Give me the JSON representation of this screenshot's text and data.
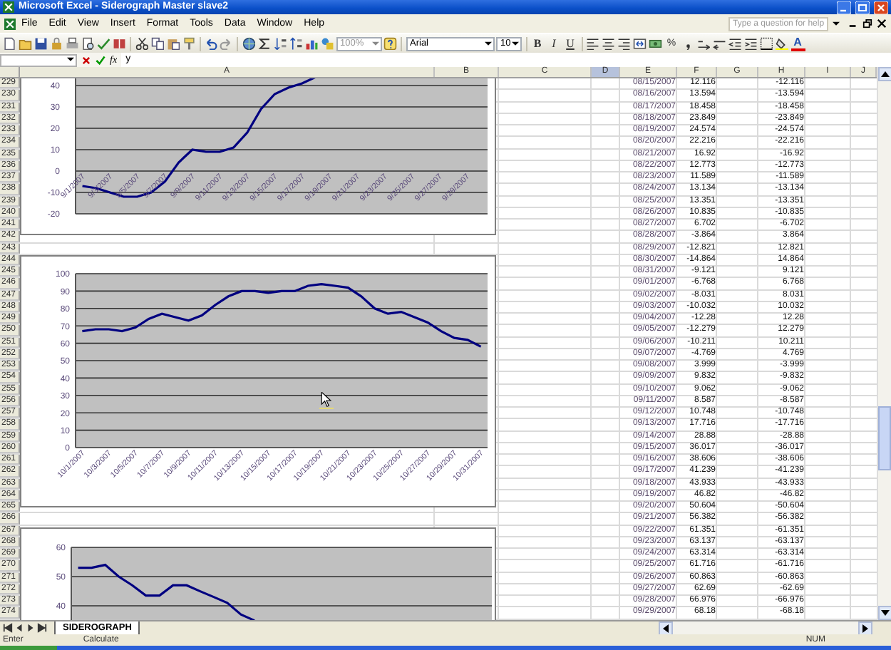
{
  "window": {
    "title": "Microsoft Excel - Siderograph Master slave2"
  },
  "menu": {
    "items": [
      "File",
      "Edit",
      "View",
      "Insert",
      "Format",
      "Tools",
      "Data",
      "Window",
      "Help"
    ],
    "help_placeholder": "Type a question for help"
  },
  "toolbar": {
    "zoom": "100%",
    "font": "Arial",
    "font_size": "10",
    "format_buttons": [
      {
        "label": "B",
        "kind": "bold"
      },
      {
        "label": "I",
        "kind": "italic"
      },
      {
        "label": "U",
        "kind": "underline"
      }
    ],
    "percent_button": "%",
    "font_color_button": "A"
  },
  "formula_bar": {
    "function_label": "fx",
    "value": "y"
  },
  "columns": [
    {
      "label": "A",
      "selected": false
    },
    {
      "label": "B",
      "selected": false
    },
    {
      "label": "C",
      "selected": false
    },
    {
      "label": "D",
      "selected": true
    },
    {
      "label": "E",
      "selected": false
    },
    {
      "label": "F",
      "selected": false
    },
    {
      "label": "G",
      "selected": false
    },
    {
      "label": "H",
      "selected": false
    },
    {
      "label": "I",
      "selected": false
    },
    {
      "label": "J",
      "selected": false
    }
  ],
  "rows": [
    {
      "number": "229",
      "column_e": "08/15/2007",
      "column_f": "12.116",
      "column_h": "-12.116"
    },
    {
      "number": "230",
      "column_e": "08/16/2007",
      "column_f": "13.594",
      "column_h": "-13.594"
    },
    {
      "number": "231",
      "column_e": "08/17/2007",
      "column_f": "18.458",
      "column_h": "-18.458"
    },
    {
      "number": "232",
      "column_e": "08/18/2007",
      "column_f": "23.849",
      "column_h": "-23.849"
    },
    {
      "number": "233",
      "column_e": "08/19/2007",
      "column_f": "24.574",
      "column_h": "-24.574"
    },
    {
      "number": "234",
      "column_e": "08/20/2007",
      "column_f": "22.216",
      "column_h": "-22.216"
    },
    {
      "number": "235",
      "column_e": "08/21/2007",
      "column_f": "16.92",
      "column_h": "-16.92"
    },
    {
      "number": "236",
      "column_e": "08/22/2007",
      "column_f": "12.773",
      "column_h": "-12.773"
    },
    {
      "number": "237",
      "column_e": "08/23/2007",
      "column_f": "11.589",
      "column_h": "-11.589"
    },
    {
      "number": "238",
      "column_e": "08/24/2007",
      "column_f": "13.134",
      "column_h": "-13.134"
    },
    {
      "number": "239",
      "column_e": "08/25/2007",
      "column_f": "13.351",
      "column_h": "-13.351"
    },
    {
      "number": "240",
      "column_e": "08/26/2007",
      "column_f": "10.835",
      "column_h": "-10.835"
    },
    {
      "number": "241",
      "column_e": "08/27/2007",
      "column_f": "6.702",
      "column_h": "-6.702"
    },
    {
      "number": "242",
      "column_e": "08/28/2007",
      "column_f": "-3.864",
      "column_h": "3.864"
    },
    {
      "number": "243",
      "column_e": "08/29/2007",
      "column_f": "-12.821",
      "column_h": "12.821"
    },
    {
      "number": "244",
      "column_e": "08/30/2007",
      "column_f": "-14.864",
      "column_h": "14.864"
    },
    {
      "number": "245",
      "column_e": "08/31/2007",
      "column_f": "-9.121",
      "column_h": "9.121"
    },
    {
      "number": "246",
      "column_e": "09/01/2007",
      "column_f": "-6.768",
      "column_h": "6.768"
    },
    {
      "number": "247",
      "column_e": "09/02/2007",
      "column_f": "-8.031",
      "column_h": "8.031"
    },
    {
      "number": "248",
      "column_e": "09/03/2007",
      "column_f": "-10.032",
      "column_h": "10.032"
    },
    {
      "number": "249",
      "column_e": "09/04/2007",
      "column_f": "-12.28",
      "column_h": "12.28"
    },
    {
      "number": "250",
      "column_e": "09/05/2007",
      "column_f": "-12.279",
      "column_h": "12.279"
    },
    {
      "number": "251",
      "column_e": "09/06/2007",
      "column_f": "-10.211",
      "column_h": "10.211"
    },
    {
      "number": "252",
      "column_e": "09/07/2007",
      "column_f": "-4.769",
      "column_h": "4.769"
    },
    {
      "number": "253",
      "column_e": "09/08/2007",
      "column_f": "3.999",
      "column_h": "-3.999"
    },
    {
      "number": "254",
      "column_e": "09/09/2007",
      "column_f": "9.832",
      "column_h": "-9.832"
    },
    {
      "number": "255",
      "column_e": "09/10/2007",
      "column_f": "9.062",
      "column_h": "-9.062"
    },
    {
      "number": "256",
      "column_e": "09/11/2007",
      "column_f": "8.587",
      "column_h": "-8.587"
    },
    {
      "number": "257",
      "column_e": "09/12/2007",
      "column_f": "10.748",
      "column_h": "-10.748"
    },
    {
      "number": "258",
      "column_e": "09/13/2007",
      "column_f": "17.716",
      "column_h": "-17.716"
    },
    {
      "number": "259",
      "column_e": "09/14/2007",
      "column_f": "28.88",
      "column_h": "-28.88"
    },
    {
      "number": "260",
      "column_e": "09/15/2007",
      "column_f": "36.017",
      "column_h": "-36.017"
    },
    {
      "number": "261",
      "column_e": "09/16/2007",
      "column_f": "38.606",
      "column_h": "-38.606"
    },
    {
      "number": "262",
      "column_e": "09/17/2007",
      "column_f": "41.239",
      "column_h": "-41.239"
    },
    {
      "number": "263",
      "column_e": "09/18/2007",
      "column_f": "43.933",
      "column_h": "-43.933"
    },
    {
      "number": "264",
      "column_e": "09/19/2007",
      "column_f": "46.82",
      "column_h": "-46.82"
    },
    {
      "number": "265",
      "column_e": "09/20/2007",
      "column_f": "50.604",
      "column_h": "-50.604"
    },
    {
      "number": "266",
      "column_e": "09/21/2007",
      "column_f": "56.382",
      "column_h": "-56.382"
    },
    {
      "number": "267",
      "column_e": "09/22/2007",
      "column_f": "61.351",
      "column_h": "-61.351"
    },
    {
      "number": "268",
      "column_e": "09/23/2007",
      "column_f": "63.137",
      "column_h": "-63.137"
    },
    {
      "number": "269",
      "column_e": "09/24/2007",
      "column_f": "63.314",
      "column_h": "-63.314"
    },
    {
      "number": "270",
      "column_e": "09/25/2007",
      "column_f": "61.716",
      "column_h": "-61.716"
    },
    {
      "number": "271",
      "column_e": "09/26/2007",
      "column_f": "60.863",
      "column_h": "-60.863"
    },
    {
      "number": "272",
      "column_e": "09/27/2007",
      "column_f": "62.69",
      "column_h": "-62.69"
    },
    {
      "number": "273",
      "column_e": "09/28/2007",
      "column_f": "66.976",
      "column_h": "-66.976"
    },
    {
      "number": "274",
      "column_e": "09/29/2007",
      "column_f": "68.18",
      "column_h": "-68.18"
    }
  ],
  "charts": [
    {
      "chart_data": {
        "type": "line",
        "grid": true,
        "ylim": [
          -20,
          50
        ],
        "yticks": [
          -20,
          -10,
          0,
          10,
          20,
          30,
          40
        ],
        "categories": [
          "9/1/2007",
          null,
          "9/3/2007",
          null,
          "9/5/2007",
          null,
          "9/7/2007",
          null,
          "9/9/2007",
          null,
          "9/11/2007",
          null,
          "9/13/2007",
          null,
          "9/15/2007",
          null,
          "9/17/2007",
          null,
          "9/19/2007",
          null,
          "9/21/2007",
          null,
          "9/23/2007",
          null,
          "9/25/2007",
          null,
          "9/27/2007",
          null,
          "9/29/2007",
          null
        ],
        "series": [
          {
            "color": "#000080",
            "values": [
              -7,
              -8,
              -10,
              -12,
              -12,
              -10,
              -5,
              4,
              10,
              9,
              9,
              11,
              18,
              29,
              36,
              39,
              41,
              44,
              null,
              null,
              null,
              null,
              null,
              null,
              null,
              null,
              null,
              null,
              null,
              null
            ]
          }
        ]
      }
    },
    {
      "chart_data": {
        "type": "line",
        "grid": true,
        "ylim": [
          0,
          100
        ],
        "yticks": [
          0,
          10,
          20,
          30,
          40,
          50,
          60,
          70,
          80,
          90,
          100
        ],
        "categories": [
          "10/1/2007",
          null,
          "10/3/2007",
          null,
          "10/5/2007",
          null,
          "10/7/2007",
          null,
          "10/9/2007",
          null,
          "10/11/2007",
          null,
          "10/13/2007",
          null,
          "10/15/2007",
          null,
          "10/17/2007",
          null,
          "10/19/2007",
          null,
          "10/21/2007",
          null,
          "10/23/2007",
          null,
          "10/25/2007",
          null,
          "10/27/2007",
          null,
          "10/29/2007",
          null,
          "10/31/2007"
        ],
        "series": [
          {
            "color": "#000080",
            "values": [
              67,
              68,
              68,
              67,
              69,
              74,
              77,
              75,
              73,
              76,
              82,
              87,
              90,
              90,
              89,
              90,
              90,
              93,
              94,
              93,
              92,
              87,
              80,
              77,
              78,
              75,
              72,
              67,
              63,
              62,
              58
            ]
          }
        ]
      }
    },
    {
      "chart_data": {
        "type": "line",
        "grid": true,
        "ylim": [
          28,
          60
        ],
        "yticks": [
          40,
          50,
          60
        ],
        "categories": [
          null,
          null,
          null,
          null,
          null,
          null,
          null,
          null,
          null,
          null,
          null,
          null,
          null,
          null,
          null,
          null,
          null,
          null,
          null,
          null,
          null,
          null,
          null,
          null,
          null,
          null,
          null,
          null,
          null,
          null,
          null
        ],
        "series": [
          {
            "color": "#000080",
            "values": [
              53,
              53,
              54,
              50,
              47,
              43.5,
              43.5,
              47,
              47,
              45,
              43,
              41,
              37,
              35,
              null,
              null,
              null,
              null,
              null,
              null,
              null,
              null,
              null,
              null,
              null,
              null,
              null,
              null,
              null,
              null,
              null
            ]
          }
        ]
      }
    }
  ],
  "sheet_tabs": [
    {
      "label": "SIDEROGRAPH",
      "selected": true
    }
  ],
  "status_bar": {
    "mode": "Enter",
    "message": "Calculate",
    "indicator": "NUM"
  }
}
